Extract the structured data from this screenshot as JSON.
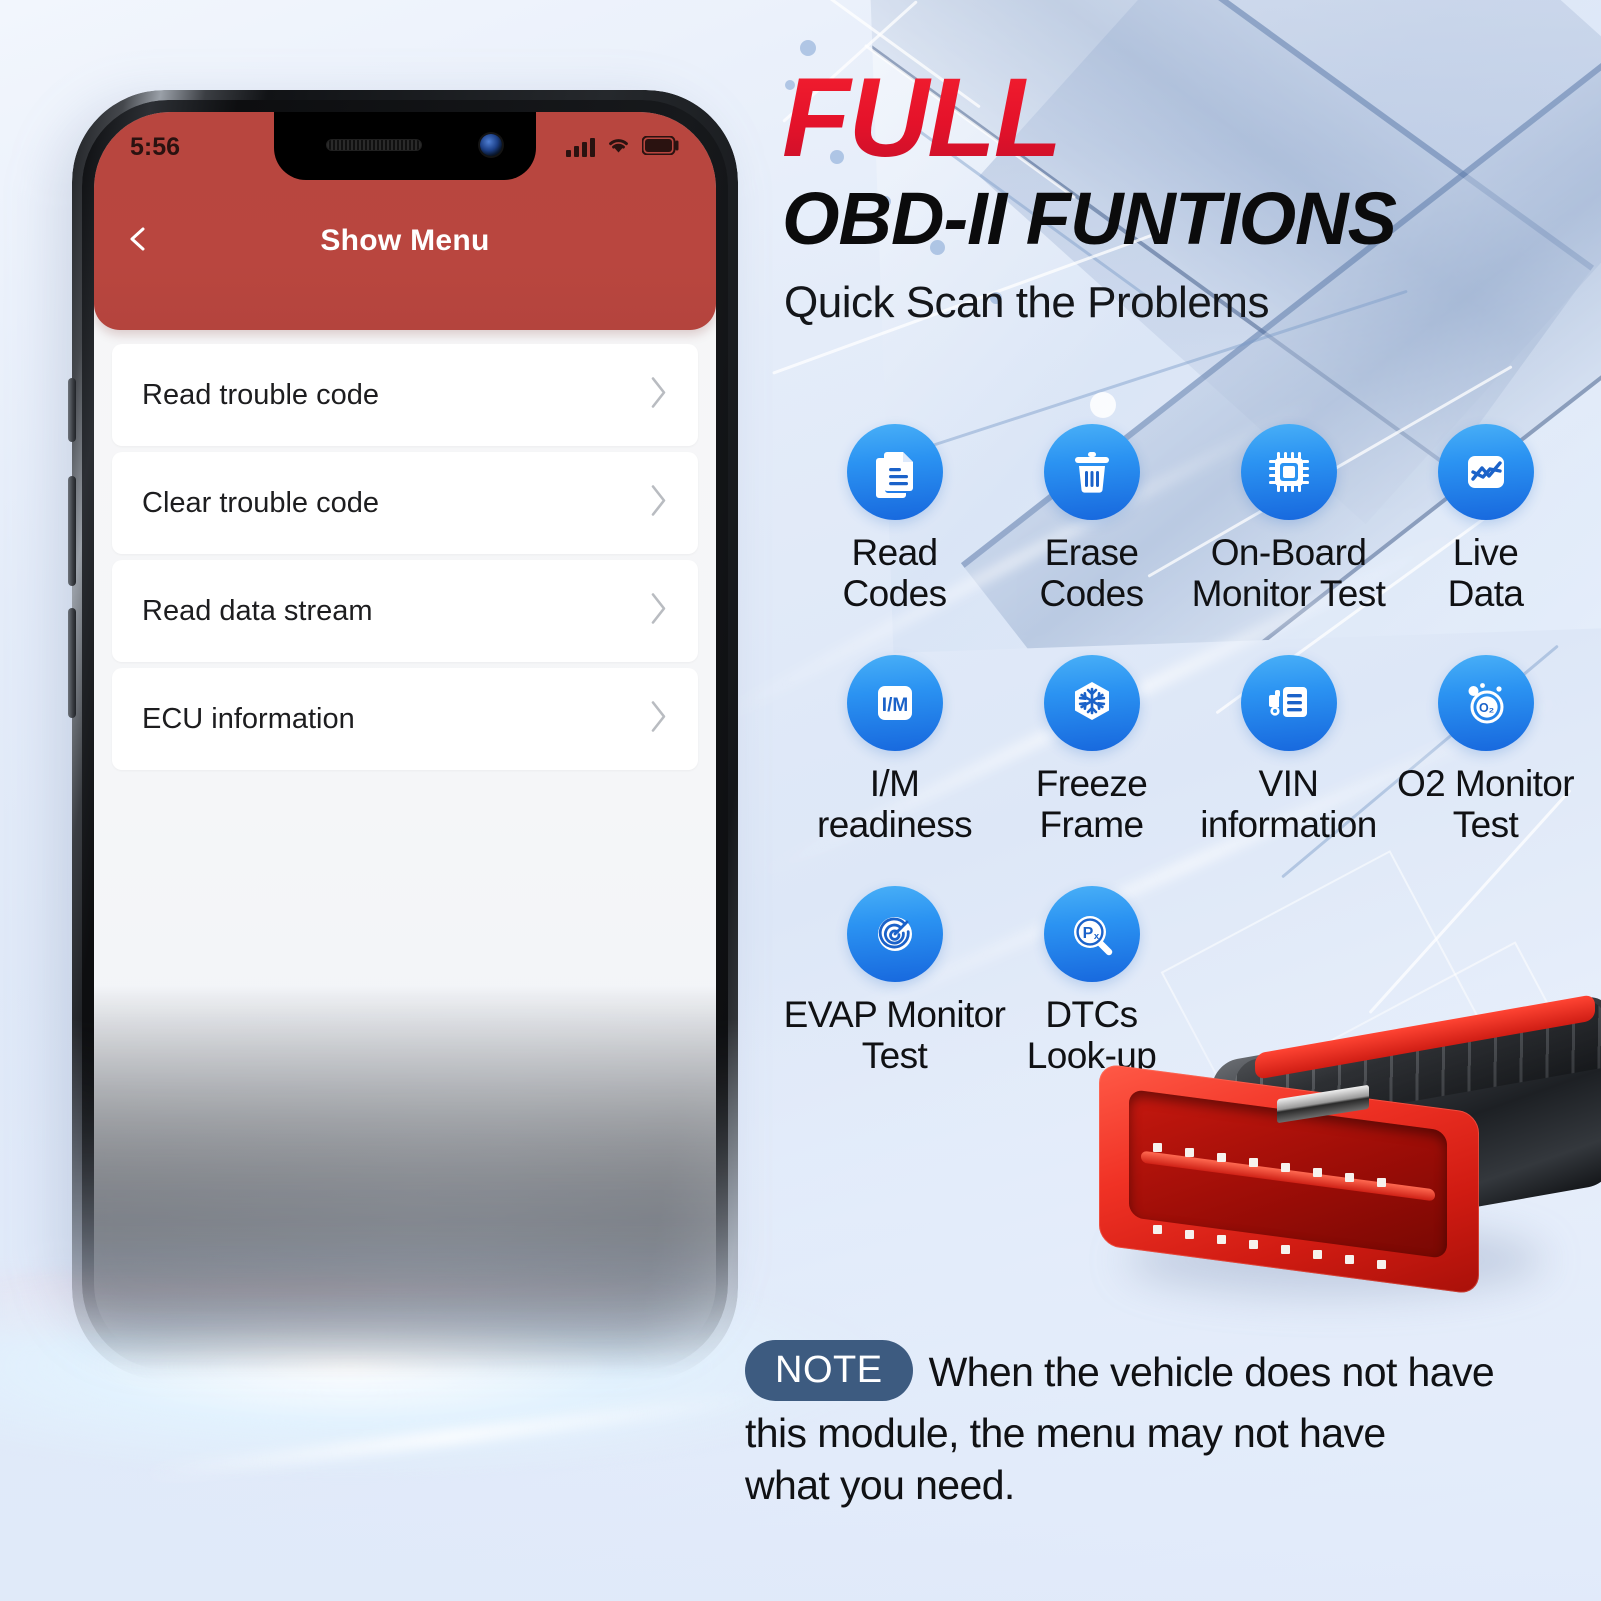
{
  "colors": {
    "brand_red": "#e8142a",
    "nav_red": "#b8463f",
    "icon_blue_light": "#49b0f7",
    "icon_blue_dark": "#1767dd",
    "note_badge": "#3d5b80",
    "text_dark": "#101114"
  },
  "phone": {
    "status_bar": {
      "time": "5:56",
      "signal_icon": "cellular-signal-icon",
      "wifi_icon": "wifi-icon",
      "battery_icon": "battery-icon"
    },
    "nav": {
      "back_icon": "chevron-left-icon",
      "title": "Show Menu"
    },
    "menu_items": [
      {
        "label": "Read trouble code",
        "chevron": "chevron-right-icon"
      },
      {
        "label": "Clear trouble code",
        "chevron": "chevron-right-icon"
      },
      {
        "label": "Read data stream",
        "chevron": "chevron-right-icon"
      },
      {
        "label": "ECU information",
        "chevron": "chevron-right-icon"
      }
    ]
  },
  "headline": {
    "line1": "FULL",
    "line2": "OBD-II FUNTIONS",
    "subtitle": "Quick Scan the Problems"
  },
  "functions": [
    {
      "icon": "documents-icon",
      "line1": "Read",
      "line2": "Codes"
    },
    {
      "icon": "trash-can-icon",
      "line1": "Erase",
      "line2": "Codes"
    },
    {
      "icon": "cpu-chip-icon",
      "line1": "On-Board",
      "line2": "Monitor Test"
    },
    {
      "icon": "line-chart-icon",
      "line1": "Live",
      "line2": "Data"
    },
    {
      "icon": "im-text-icon",
      "line1": "I/M",
      "line2": "readiness"
    },
    {
      "icon": "snowflake-icon",
      "line1": "Freeze",
      "line2": "Frame"
    },
    {
      "icon": "truck-document-icon",
      "line1": "VIN",
      "line2": "information"
    },
    {
      "icon": "o2-bubbles-icon",
      "line1": "O2 Monitor",
      "line2": "Test"
    },
    {
      "icon": "radar-target-icon",
      "line1": "EVAP Monitor",
      "line2": "Test"
    },
    {
      "icon": "magnifier-px-icon",
      "line1": "DTCs",
      "line2": "Look-up"
    }
  ],
  "note": {
    "badge": "NOTE",
    "line1": "When the vehicle does not have",
    "line2": "this module, the menu may not have",
    "line3": "what you need."
  },
  "product": {
    "connector_name": "obd2-connector"
  }
}
